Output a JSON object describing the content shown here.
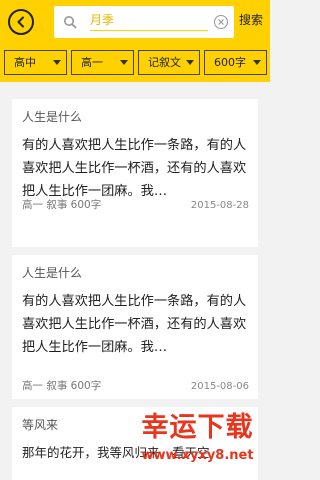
{
  "header": {
    "search_value": "月季",
    "search_button": "搜索"
  },
  "filters": [
    {
      "label": "高中"
    },
    {
      "label": "高一"
    },
    {
      "label": "记叙文"
    },
    {
      "label": "600字"
    }
  ],
  "articles": [
    {
      "title": "人生是什么",
      "excerpt": "有的人喜欢把人生比作一条路，有的人喜欢把人生比作一杯酒，还有的人喜欢把人生比作一团麻。我…",
      "meta": "高一 叙事 600字",
      "date": "2015-08-28"
    },
    {
      "title": "人生是什么",
      "excerpt": "有的人喜欢把人生比作一条路，有的人喜欢把人生比作一杯酒，还有的人喜欢把人生比作一团麻。我…",
      "meta": "高一 叙事 600字",
      "date": "2015-08-06"
    },
    {
      "title": "等风来",
      "excerpt": "那年的花开，我等风归来，看天空"
    }
  ],
  "watermark": {
    "title": "幸运下载",
    "url": "www.xyxy8.net"
  },
  "colors": {
    "accent": "#ffd100",
    "watermark": "#e8351c"
  },
  "icons": [
    "chevron-left-icon",
    "search-icon",
    "clear-icon",
    "caret-down-icon"
  ]
}
